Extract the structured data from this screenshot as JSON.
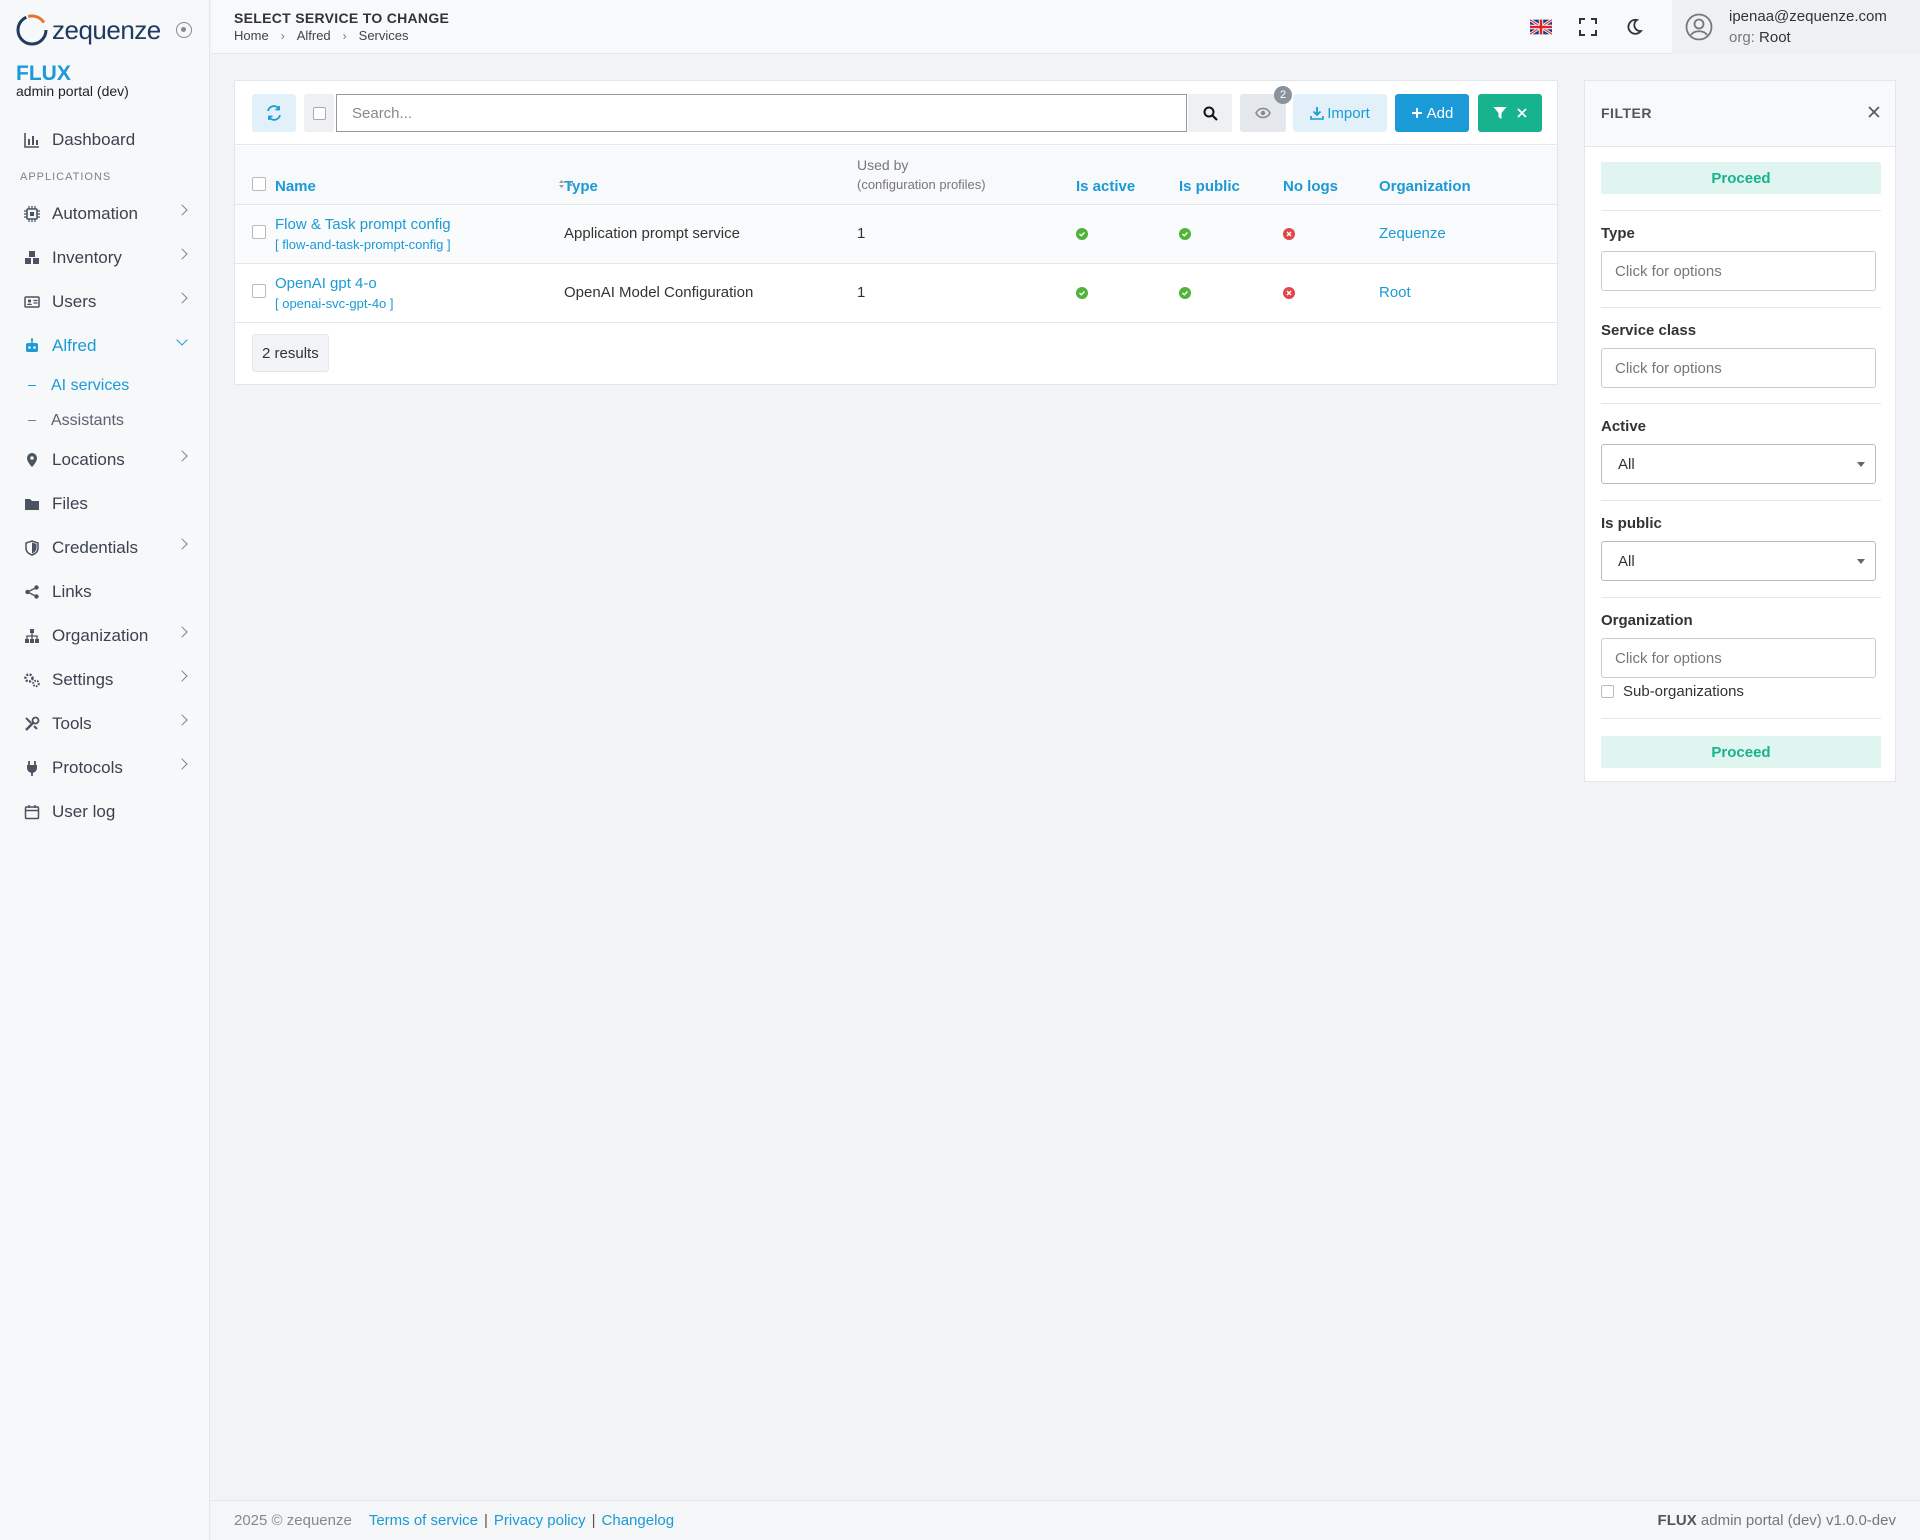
{
  "brand": {
    "name": "zequenze",
    "product": "FLUX",
    "subtitle": "admin portal (dev)"
  },
  "sidebar": {
    "dashboard": "Dashboard",
    "section_label": "APPLICATIONS",
    "items": [
      {
        "label": "Automation",
        "icon": "chip-icon"
      },
      {
        "label": "Inventory",
        "icon": "boxes-icon"
      },
      {
        "label": "Users",
        "icon": "id-card-icon"
      },
      {
        "label": "Alfred",
        "icon": "robot-icon"
      },
      {
        "label": "Locations",
        "icon": "map-pin-icon"
      },
      {
        "label": "Files",
        "icon": "folder-icon"
      },
      {
        "label": "Credentials",
        "icon": "shield-icon"
      },
      {
        "label": "Links",
        "icon": "share-icon"
      },
      {
        "label": "Organization",
        "icon": "sitemap-icon"
      },
      {
        "label": "Settings",
        "icon": "gears-icon"
      },
      {
        "label": "Tools",
        "icon": "tools-icon"
      },
      {
        "label": "Protocols",
        "icon": "plug-icon"
      },
      {
        "label": "User log",
        "icon": "calendar-icon"
      }
    ],
    "alfred_sub": [
      "AI services",
      "Assistants"
    ]
  },
  "header": {
    "title": "SELECT SERVICE TO CHANGE",
    "breadcrumb": [
      "Home",
      "Alfred",
      "Services"
    ],
    "user_email": "ipenaa@zequenze.com",
    "org_label": "org:",
    "org_value": "Root"
  },
  "toolbar": {
    "search_placeholder": "Search...",
    "eye_badge": "2",
    "import_label": "Import",
    "add_label": "Add"
  },
  "table": {
    "columns": {
      "name": "Name",
      "type": "Type",
      "used_by": "Used by",
      "used_by_sub": "(configuration profiles)",
      "is_active": "Is active",
      "is_public": "Is public",
      "no_logs": "No logs",
      "organization": "Organization"
    },
    "rows": [
      {
        "name": "Flow & Task prompt config",
        "slug": "[ flow-and-task-prompt-config ]",
        "type": "Application prompt service",
        "used_by": "1",
        "is_active": true,
        "is_public": true,
        "no_logs": false,
        "organization": "Zequenze"
      },
      {
        "name": "OpenAI gpt 4-o",
        "slug": "[ openai-svc-gpt-4o ]",
        "type": "OpenAI Model Configuration",
        "used_by": "1",
        "is_active": true,
        "is_public": true,
        "no_logs": false,
        "organization": "Root"
      }
    ],
    "results": "2 results"
  },
  "filter": {
    "title": "FILTER",
    "proceed": "Proceed",
    "type_label": "Type",
    "type_placeholder": "Click for options",
    "service_class_label": "Service class",
    "service_class_placeholder": "Click for options",
    "active_label": "Active",
    "active_value": "All",
    "is_public_label": "Is public",
    "is_public_value": "All",
    "organization_label": "Organization",
    "organization_placeholder": "Click for options",
    "sub_orgs_label": "Sub-organizations"
  },
  "footer": {
    "copyright": "2025 © zequenze",
    "terms": "Terms of service",
    "privacy": "Privacy policy",
    "changelog": "Changelog",
    "sep": "|",
    "product": "FLUX",
    "version": "admin portal (dev) v1.0.0-dev"
  },
  "colors": {
    "accent": "#1a9ad6",
    "success": "#16b38e",
    "ok": "#52b23a",
    "error": "#e0474c"
  }
}
